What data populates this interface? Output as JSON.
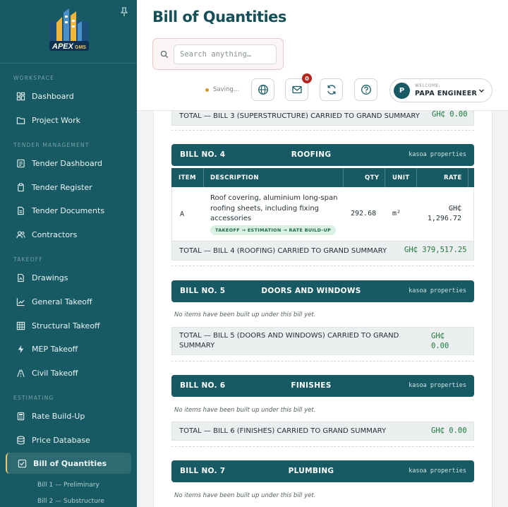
{
  "sidebar": {
    "logo_text": "APEX",
    "sections": {
      "workspace": "WORKSPACE",
      "tender": "TENDER MANAGEMENT",
      "takeoff": "TAKEOFF",
      "estimating": "ESTIMATING"
    },
    "items": {
      "dashboard": "Dashboard",
      "project_work": "Project Work",
      "tender_dashboard": "Tender Dashboard",
      "tender_register": "Tender Register",
      "tender_documents": "Tender Documents",
      "contractors": "Contractors",
      "drawings": "Drawings",
      "general_takeoff": "General Takeoff",
      "structural_takeoff": "Structural Takeoff",
      "mep_takeoff": "MEP Takeoff",
      "civil_takeoff": "Civil Takeoff",
      "rate_buildup": "Rate Build-Up",
      "price_database": "Price Database",
      "bill_of_quantities": "Bill of Quantities"
    },
    "sub_items": [
      "Bill 1 — Preliminary",
      "Bill 2 — Substructure"
    ]
  },
  "header": {
    "title": "Bill of Quantities",
    "search_placeholder": "Search anything…",
    "saving": "Saving…",
    "notification_count": "0",
    "welcome": "WELCOME,",
    "user_name": "PAPA ENGINEER",
    "avatar_initial": "P"
  },
  "bills": {
    "bill3_total": {
      "label": "TOTAL — BILL 3 (SUPERSTRUCTURE) CARRIED TO GRAND SUMMARY",
      "amount": "GH₵ 0.00"
    },
    "bill4": {
      "no": "BILL NO. 4",
      "name": "ROOFING",
      "client": "kasoa properties",
      "columns": {
        "item": "ITEM",
        "description": "DESCRIPTION",
        "qty": "QTY",
        "unit": "UNIT",
        "rate": "RATE"
      },
      "row": {
        "item": "A",
        "description": "Roof covering, aluminium long-span roofing sheets, including fixing accessories",
        "qty": "292.68",
        "unit": "m²",
        "rate_currency": "GH₵",
        "rate_value": "1,296.72",
        "chip": "TAKEOFF → ESTIMATION → RATE BUILD-UP"
      },
      "total": {
        "label": "TOTAL — BILL 4 (ROOFING) CARRIED TO GRAND SUMMARY",
        "amount": "GH₵ 379,517.25"
      }
    },
    "bill5": {
      "no": "BILL NO. 5",
      "name": "DOORS AND WINDOWS",
      "client": "kasoa properties",
      "empty": "No items have been built up under this bill yet.",
      "total_line1": "TOTAL — BILL 5 (DOORS AND WINDOWS) CARRIED TO GRAND",
      "total_line2": "SUMMARY",
      "amount_line1": "GH₵",
      "amount_line2": "0.00"
    },
    "bill6": {
      "no": "BILL NO. 6",
      "name": "FINISHES",
      "client": "kasoa properties",
      "empty": "No items have been built up under this bill yet.",
      "total": {
        "label": "TOTAL — BILL 6 (FINISHES) CARRIED TO GRAND SUMMARY",
        "amount": "GH₵ 0.00"
      }
    },
    "bill7": {
      "no": "BILL NO. 7",
      "name": "PLUMBING",
      "client": "kasoa properties",
      "empty": "No items have been built up under this bill yet."
    }
  },
  "colors": {
    "sidebar_bg": "#175a63",
    "accent": "#f0c96a",
    "amount_green": "#1f7a3c",
    "badge_red": "#b3261e"
  }
}
